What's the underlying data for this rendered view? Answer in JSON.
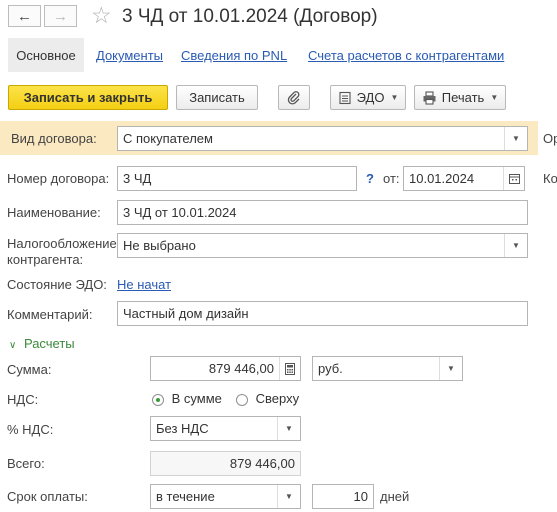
{
  "window": {
    "title": "3 ЧД от 10.01.2024 (Договор)"
  },
  "tabs": [
    {
      "label": "Основное",
      "active": true
    },
    {
      "label": "Документы"
    },
    {
      "label": "Сведения по PNL"
    },
    {
      "label": "Счета расчетов с контрагентами"
    }
  ],
  "toolbar": {
    "save_close_label": "Записать и закрыть",
    "save_label": "Записать",
    "edo_label": "ЭДО",
    "print_label": "Печать"
  },
  "form": {
    "contract_type": {
      "label": "Вид договора:",
      "value": "С покупателем"
    },
    "number": {
      "label": "Номер договора:",
      "value": "3 ЧД",
      "help": "?",
      "from_label": "от:",
      "date": "10.01.2024"
    },
    "name": {
      "label": "Наименование:",
      "value": "3 ЧД от 10.01.2024"
    },
    "tax": {
      "label_line1": "Налогообложение",
      "label_line2": "контрагента:",
      "value": "Не выбрано"
    },
    "edo_state": {
      "label": "Состояние ЭДО:",
      "value": "Не начат"
    },
    "comment": {
      "label": "Комментарий:",
      "value": "Частный дом дизайн"
    },
    "settlements_header": "Расчеты",
    "amount": {
      "label": "Сумма:",
      "value": "879 446,00",
      "currency": "руб."
    },
    "vat": {
      "label": "НДС:",
      "option_in_sum": "В сумме",
      "option_on_top": "Сверху",
      "selected": "В сумме"
    },
    "vat_rate": {
      "label": "% НДС:",
      "value": "Без НДС"
    },
    "total": {
      "label": "Всего:",
      "value": "879 446,00"
    },
    "payment_term": {
      "label": "Срок оплаты:",
      "type": "в течение",
      "days": "10",
      "unit": "дней"
    }
  },
  "right_cut_labels": [
    "Ор",
    "Ко"
  ]
}
